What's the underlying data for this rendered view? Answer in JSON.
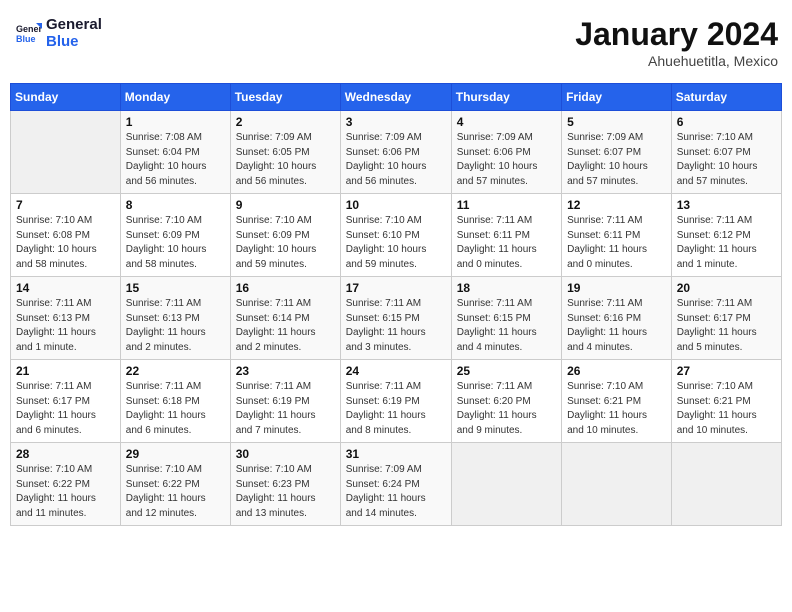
{
  "header": {
    "logo_line1": "General",
    "logo_line2": "Blue",
    "month_year": "January 2024",
    "location": "Ahuehuetitla, Mexico"
  },
  "weekdays": [
    "Sunday",
    "Monday",
    "Tuesday",
    "Wednesday",
    "Thursday",
    "Friday",
    "Saturday"
  ],
  "weeks": [
    [
      {
        "day": "",
        "info": ""
      },
      {
        "day": "1",
        "info": "Sunrise: 7:08 AM\nSunset: 6:04 PM\nDaylight: 10 hours\nand 56 minutes."
      },
      {
        "day": "2",
        "info": "Sunrise: 7:09 AM\nSunset: 6:05 PM\nDaylight: 10 hours\nand 56 minutes."
      },
      {
        "day": "3",
        "info": "Sunrise: 7:09 AM\nSunset: 6:06 PM\nDaylight: 10 hours\nand 56 minutes."
      },
      {
        "day": "4",
        "info": "Sunrise: 7:09 AM\nSunset: 6:06 PM\nDaylight: 10 hours\nand 57 minutes."
      },
      {
        "day": "5",
        "info": "Sunrise: 7:09 AM\nSunset: 6:07 PM\nDaylight: 10 hours\nand 57 minutes."
      },
      {
        "day": "6",
        "info": "Sunrise: 7:10 AM\nSunset: 6:07 PM\nDaylight: 10 hours\nand 57 minutes."
      }
    ],
    [
      {
        "day": "7",
        "info": "Sunrise: 7:10 AM\nSunset: 6:08 PM\nDaylight: 10 hours\nand 58 minutes."
      },
      {
        "day": "8",
        "info": "Sunrise: 7:10 AM\nSunset: 6:09 PM\nDaylight: 10 hours\nand 58 minutes."
      },
      {
        "day": "9",
        "info": "Sunrise: 7:10 AM\nSunset: 6:09 PM\nDaylight: 10 hours\nand 59 minutes."
      },
      {
        "day": "10",
        "info": "Sunrise: 7:10 AM\nSunset: 6:10 PM\nDaylight: 10 hours\nand 59 minutes."
      },
      {
        "day": "11",
        "info": "Sunrise: 7:11 AM\nSunset: 6:11 PM\nDaylight: 11 hours\nand 0 minutes."
      },
      {
        "day": "12",
        "info": "Sunrise: 7:11 AM\nSunset: 6:11 PM\nDaylight: 11 hours\nand 0 minutes."
      },
      {
        "day": "13",
        "info": "Sunrise: 7:11 AM\nSunset: 6:12 PM\nDaylight: 11 hours\nand 1 minute."
      }
    ],
    [
      {
        "day": "14",
        "info": "Sunrise: 7:11 AM\nSunset: 6:13 PM\nDaylight: 11 hours\nand 1 minute."
      },
      {
        "day": "15",
        "info": "Sunrise: 7:11 AM\nSunset: 6:13 PM\nDaylight: 11 hours\nand 2 minutes."
      },
      {
        "day": "16",
        "info": "Sunrise: 7:11 AM\nSunset: 6:14 PM\nDaylight: 11 hours\nand 2 minutes."
      },
      {
        "day": "17",
        "info": "Sunrise: 7:11 AM\nSunset: 6:15 PM\nDaylight: 11 hours\nand 3 minutes."
      },
      {
        "day": "18",
        "info": "Sunrise: 7:11 AM\nSunset: 6:15 PM\nDaylight: 11 hours\nand 4 minutes."
      },
      {
        "day": "19",
        "info": "Sunrise: 7:11 AM\nSunset: 6:16 PM\nDaylight: 11 hours\nand 4 minutes."
      },
      {
        "day": "20",
        "info": "Sunrise: 7:11 AM\nSunset: 6:17 PM\nDaylight: 11 hours\nand 5 minutes."
      }
    ],
    [
      {
        "day": "21",
        "info": "Sunrise: 7:11 AM\nSunset: 6:17 PM\nDaylight: 11 hours\nand 6 minutes."
      },
      {
        "day": "22",
        "info": "Sunrise: 7:11 AM\nSunset: 6:18 PM\nDaylight: 11 hours\nand 6 minutes."
      },
      {
        "day": "23",
        "info": "Sunrise: 7:11 AM\nSunset: 6:19 PM\nDaylight: 11 hours\nand 7 minutes."
      },
      {
        "day": "24",
        "info": "Sunrise: 7:11 AM\nSunset: 6:19 PM\nDaylight: 11 hours\nand 8 minutes."
      },
      {
        "day": "25",
        "info": "Sunrise: 7:11 AM\nSunset: 6:20 PM\nDaylight: 11 hours\nand 9 minutes."
      },
      {
        "day": "26",
        "info": "Sunrise: 7:10 AM\nSunset: 6:21 PM\nDaylight: 11 hours\nand 10 minutes."
      },
      {
        "day": "27",
        "info": "Sunrise: 7:10 AM\nSunset: 6:21 PM\nDaylight: 11 hours\nand 10 minutes."
      }
    ],
    [
      {
        "day": "28",
        "info": "Sunrise: 7:10 AM\nSunset: 6:22 PM\nDaylight: 11 hours\nand 11 minutes."
      },
      {
        "day": "29",
        "info": "Sunrise: 7:10 AM\nSunset: 6:22 PM\nDaylight: 11 hours\nand 12 minutes."
      },
      {
        "day": "30",
        "info": "Sunrise: 7:10 AM\nSunset: 6:23 PM\nDaylight: 11 hours\nand 13 minutes."
      },
      {
        "day": "31",
        "info": "Sunrise: 7:09 AM\nSunset: 6:24 PM\nDaylight: 11 hours\nand 14 minutes."
      },
      {
        "day": "",
        "info": ""
      },
      {
        "day": "",
        "info": ""
      },
      {
        "day": "",
        "info": ""
      }
    ]
  ]
}
